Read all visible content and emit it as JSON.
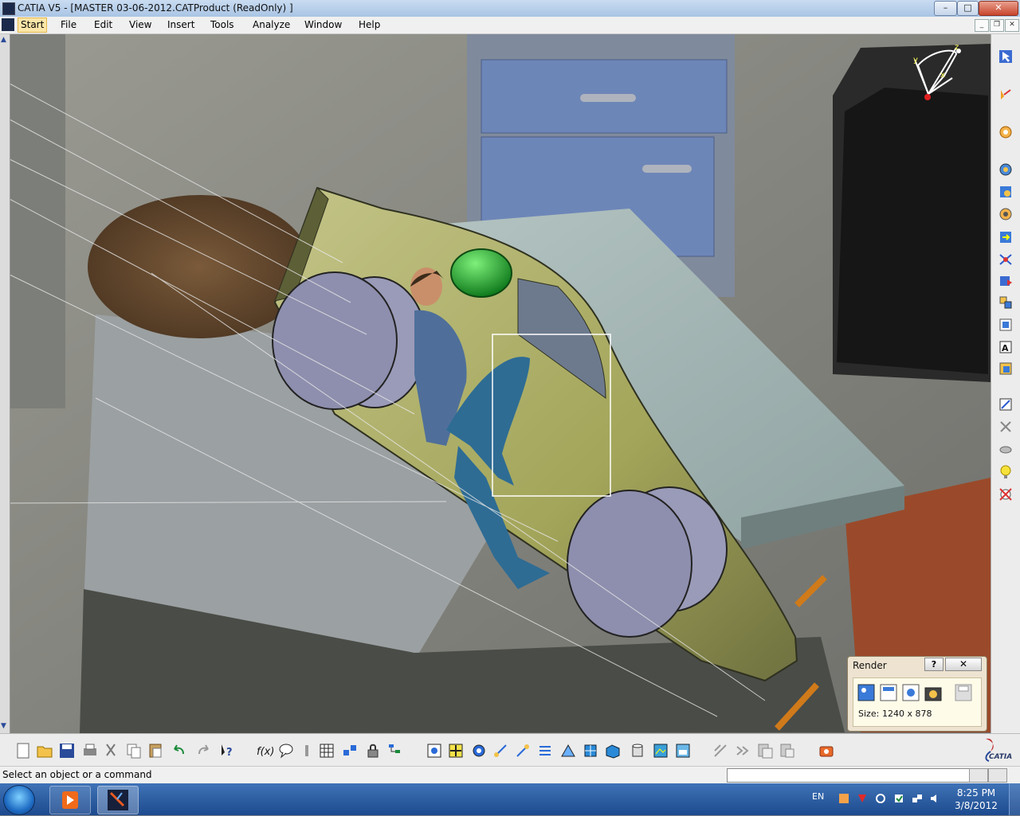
{
  "window": {
    "title": "CATIA V5 - [MASTER 03-06-2012.CATProduct (ReadOnly) ]",
    "controls": {
      "minimize": "–",
      "maximize": "□",
      "close": "✕"
    }
  },
  "menubar": {
    "items": [
      {
        "label": "Start"
      },
      {
        "label": "File"
      },
      {
        "label": "Edit"
      },
      {
        "label": "View"
      },
      {
        "label": "Insert"
      },
      {
        "label": "Tools"
      },
      {
        "label": "Analyze"
      },
      {
        "label": "Window"
      },
      {
        "label": "Help"
      }
    ],
    "doc_controls": {
      "minimize": "_",
      "restore": "❐",
      "close": "✕"
    }
  },
  "compass": {
    "axes": [
      "x",
      "y",
      "z"
    ]
  },
  "render_panel": {
    "title": "Render",
    "help": "?",
    "close": "✕",
    "size_label": "Size:",
    "size_value": "1240 x 878"
  },
  "status": {
    "message": "Select an object or a command",
    "input_value": ""
  },
  "brand": {
    "logo_text": "CATIA"
  },
  "taskbar": {
    "lang": "EN",
    "time": "8:25 PM",
    "date": "3/8/2012"
  },
  "colors": {
    "titlebar": "#b7cde9",
    "car_body": "#a9ab62",
    "wheel": "#8e8fae",
    "helmet": "#1fa52c",
    "countertop": "#a8b8b6",
    "cabinet": "#6d86b8",
    "oven": "#1c1c1c",
    "tile": "#9a4a2a"
  },
  "toolbar_icons": {
    "right": [
      "select-arrow-icon",
      "sketcher-icon",
      "assembly-constraint-icon",
      "product-structure-icon",
      "manipulate-icon",
      "snap-icon",
      "explode-icon",
      "clash-icon",
      "sectioning-icon",
      "distance-icon",
      "catalog-icon",
      "text-annotation-icon",
      "component-icon",
      "measure-icon",
      "swap-visible-icon",
      "fly-mode-icon",
      "light-icon",
      "no-show-icon"
    ],
    "bottom": [
      "new-icon",
      "open-icon",
      "save-icon",
      "print-icon",
      "cut-icon",
      "copy-icon",
      "paste-icon",
      "undo-icon",
      "redo-icon",
      "whats-this-icon",
      "formula-icon",
      "comment-icon",
      "table-icon",
      "grid-icon",
      "lock-icon",
      "tree-icon",
      "fit-all-icon",
      "pan-icon",
      "rotate-icon",
      "zoom-in-icon",
      "zoom-out-icon",
      "normal-view-icon",
      "iso-view-icon",
      "cube-view-icon",
      "shading-icon",
      "cylinder-icon",
      "texture-icon",
      "image-icon",
      "render-icon",
      "sectioning-icon",
      "video-icon",
      "capture-icon"
    ]
  }
}
